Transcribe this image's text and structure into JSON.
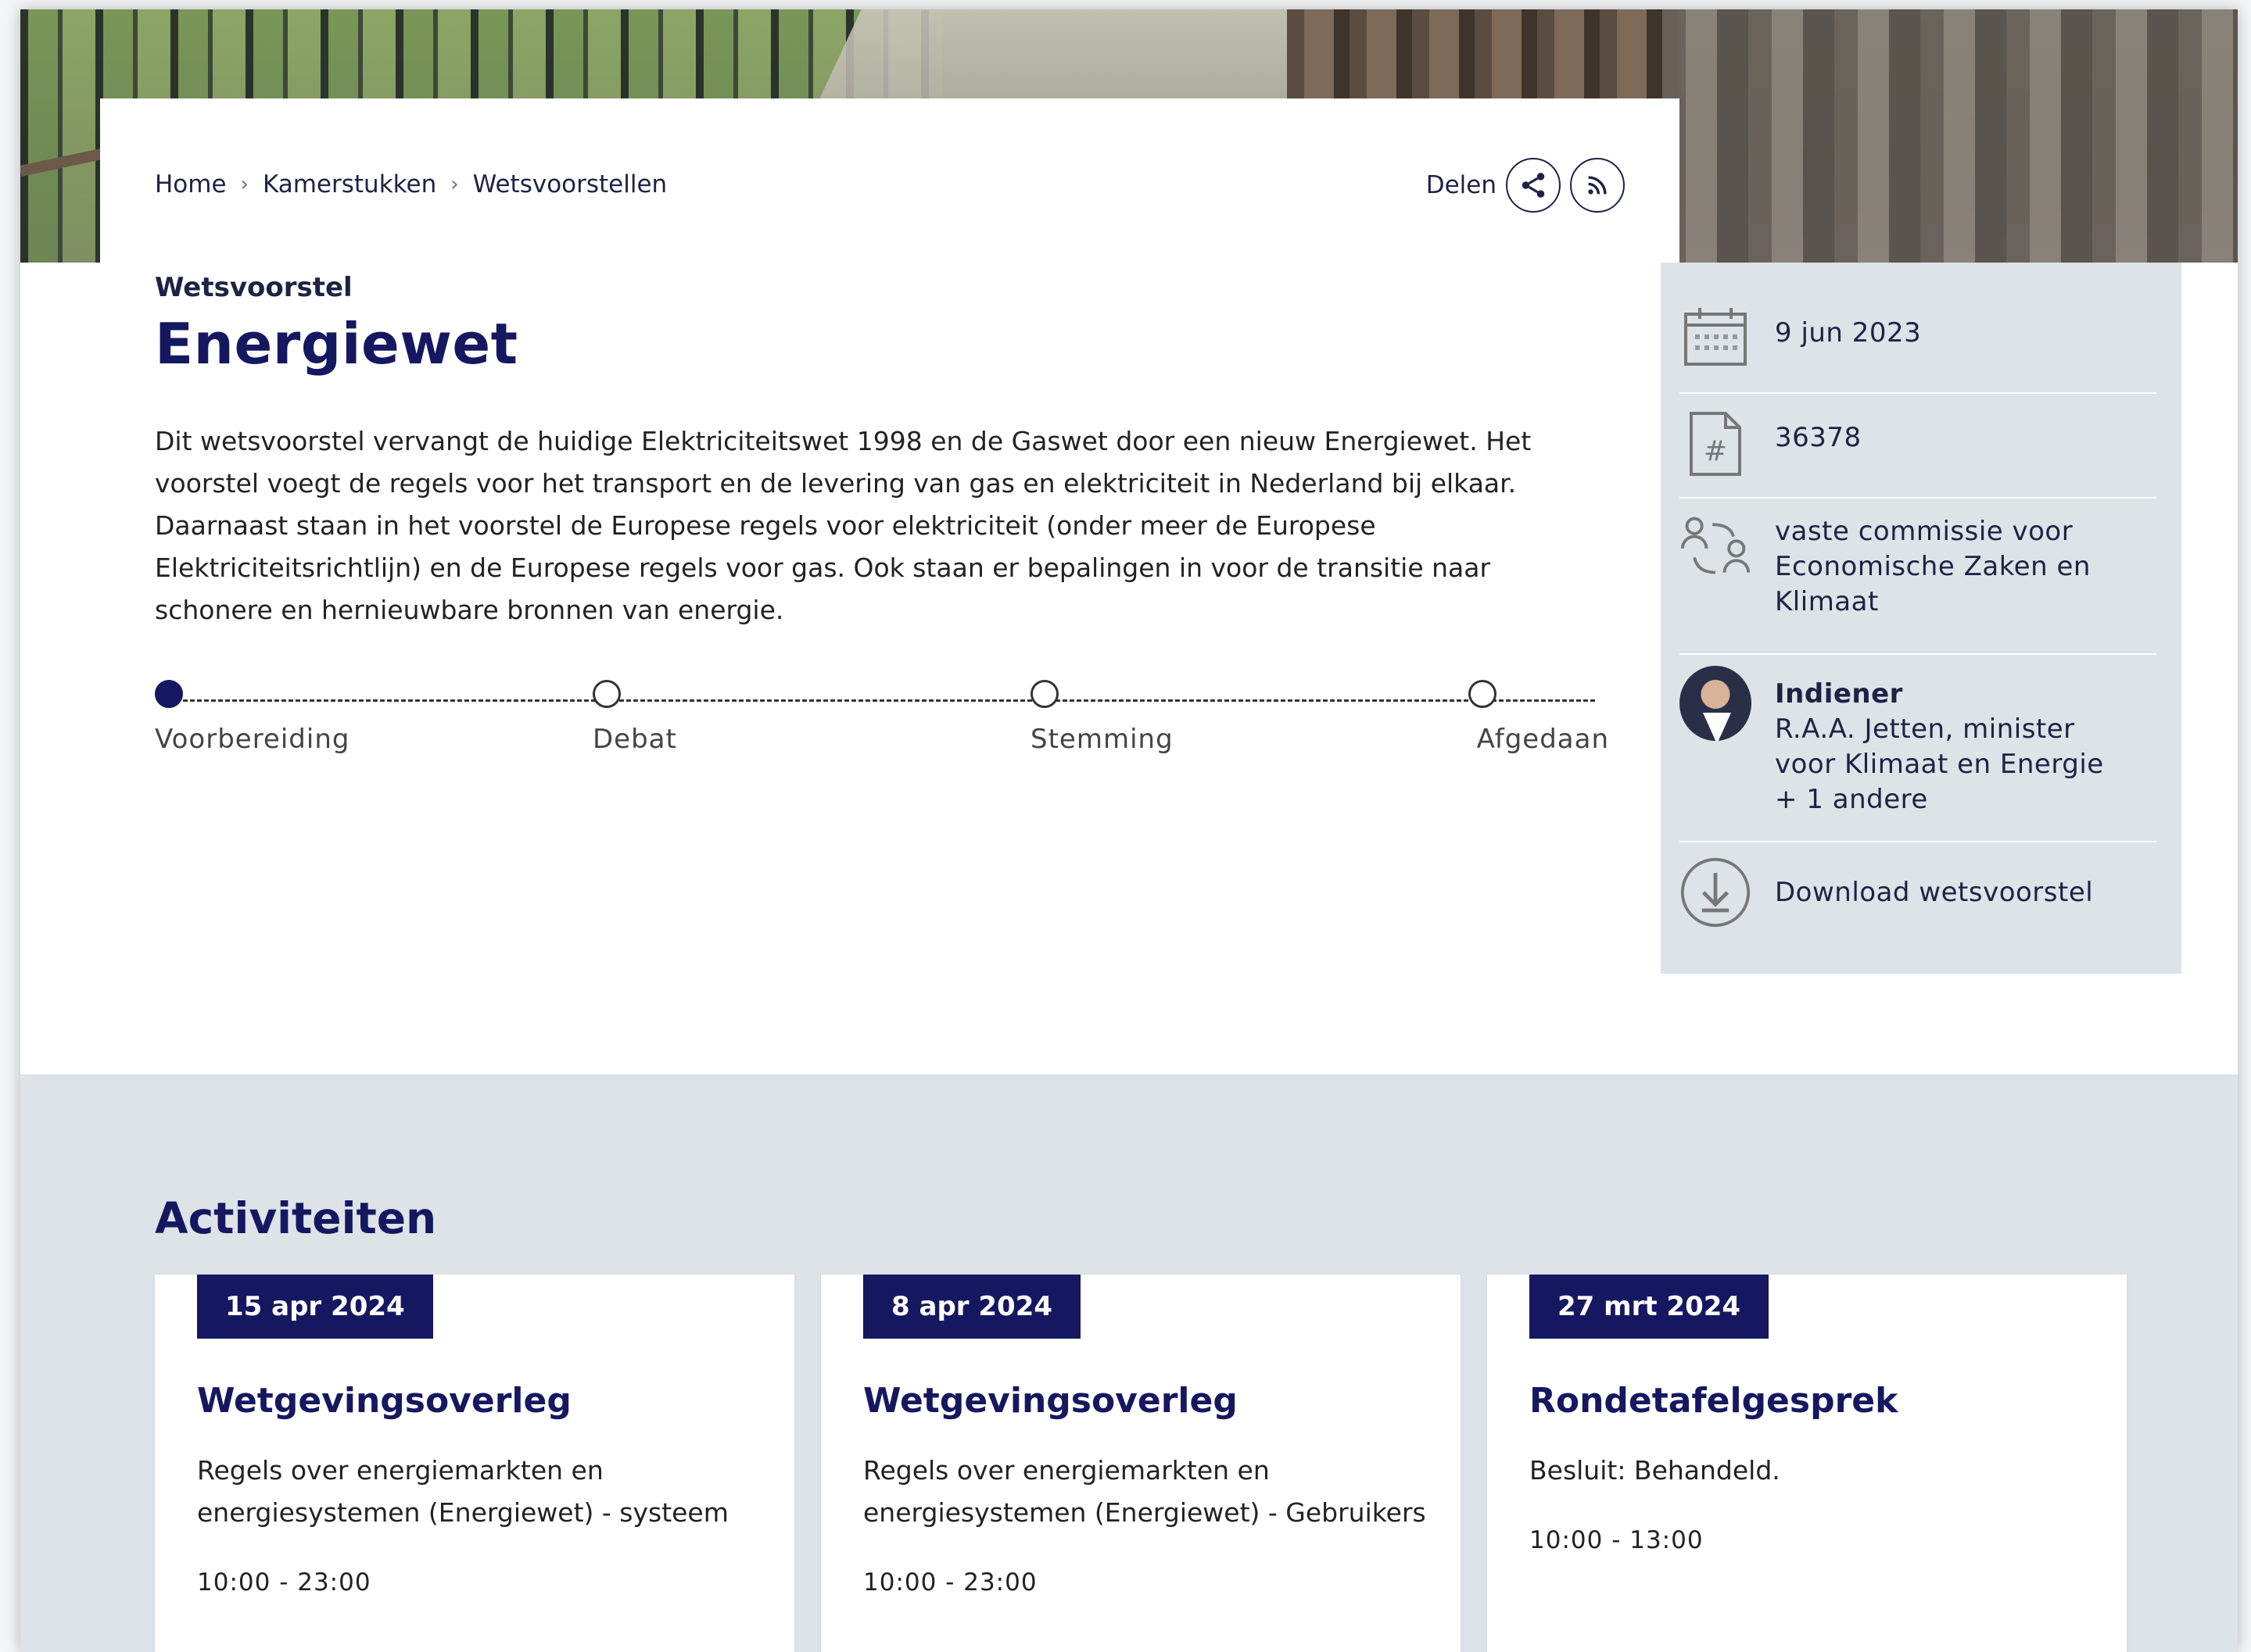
{
  "breadcrumb": {
    "items": [
      "Home",
      "Kamerstukken",
      "Wetsvoorstellen"
    ],
    "separator": "›"
  },
  "share": {
    "label": "Delen",
    "share_icon": "share-icon",
    "rss_icon": "rss-icon"
  },
  "bill": {
    "kicker": "Wetsvoorstel",
    "title": "Energiewet",
    "description": "Dit wetsvoorstel vervangt de huidige Elektriciteitswet 1998 en de Gaswet door een nieuw Energiewet. Het voorstel voegt de regels voor het transport en de levering van gas en elektriciteit in Nederland bij elkaar. Daarnaast staan in het voorstel de Europese regels voor elektriciteit (onder meer de Europese Elektriciteitsrichtlijn) en de Europese regels voor gas. Ook staan er bepalingen in voor de transitie naar schonere en hernieuwbare bronnen van energie."
  },
  "progress": {
    "steps": [
      "Voorbereiding",
      "Debat",
      "Stemming",
      "Afgedaan"
    ],
    "active_index": 0
  },
  "sidebar": {
    "date": "9 jun 2023",
    "number": "36378",
    "committee": "vaste commissie voor Economische Zaken en Klimaat",
    "submitter_label": "Indiener",
    "submitter_name": "R.A.A. Jetten, minister voor Klimaat en Energie",
    "submitter_more": "+ 1 andere",
    "download_label": "Download wetsvoorstel"
  },
  "activities": {
    "title": "Activiteiten",
    "cards": [
      {
        "date": "15 apr 2024",
        "title": "Wetgevingsoverleg",
        "description": "Regels over energiemarkten en energiesystemen (Energiewet) - systeem",
        "time": "10:00 - 23:00"
      },
      {
        "date": "8 apr 2024",
        "title": "Wetgevingsoverleg",
        "description": "Regels over energiemarkten en energiesystemen (Energiewet) - Gebruikers",
        "time": "10:00 - 23:00"
      },
      {
        "date": "27 mrt 2024",
        "title": "Rondetafelgesprek",
        "description": "Besluit: Behandeld.",
        "time": "10:00 - 13:00"
      }
    ]
  },
  "colors": {
    "primary": "#151860",
    "sidebar_bg": "#dde3e7",
    "text": "#1e2245"
  }
}
